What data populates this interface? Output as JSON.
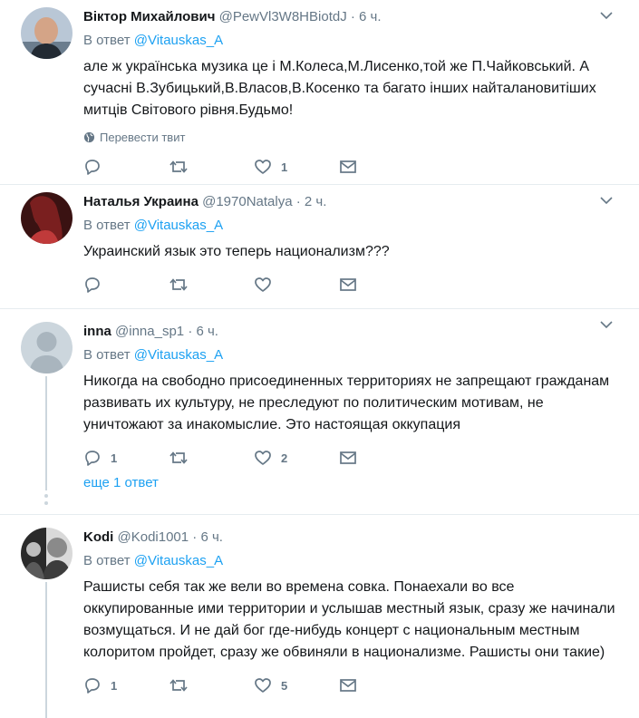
{
  "tweets": [
    {
      "name": "Віктор Михайлович",
      "handle": "@PewVl3W8HBiotdJ",
      "dot": "·",
      "time": "6 ч.",
      "reply_prefix": "В ответ",
      "reply_to": "@Vitauskas_A",
      "text": "але ж українська музика це і М.Колеса,М.Лисенко,той же П.Чайковський. А сучасні В.Зубицький,В.Власов,В.Косенко та багато інших найталановитіших митців Світового рівня.Будьмо!",
      "translate": "Перевести твит",
      "replies": "",
      "retweets": "",
      "likes": "1"
    },
    {
      "name": "Наталья Украина",
      "handle": "@1970Natalya",
      "dot": "·",
      "time": "2 ч.",
      "reply_prefix": "В ответ",
      "reply_to": "@Vitauskas_A",
      "text": "Украинский язык это теперь национализм???",
      "replies": "",
      "retweets": "",
      "likes": ""
    },
    {
      "name": "inna",
      "handle": "@inna_sp1",
      "dot": "·",
      "time": "6 ч.",
      "reply_prefix": "В ответ",
      "reply_to": "@Vitauskas_A",
      "text": "Никогда на свободно присоединенных территориях не запрещают гражданам развивать их культуру, не преследуют по политическим мотивам, не уничтожают за инакомыслие. Это настоящая оккупация",
      "replies": "1",
      "retweets": "",
      "likes": "2",
      "more_replies": "еще 1 ответ"
    },
    {
      "name": "Kodi",
      "handle": "@Kodi1001",
      "dot": "·",
      "time": "6 ч.",
      "reply_prefix": "В ответ",
      "reply_to": "@Vitauskas_A",
      "text": "Рашисты себя так же вели во времена совка. Понаехали во все оккупированные ими территории и услышав местный язык, сразу же начинали возмущаться. И не дай бог где-нибудь концерт с национальным местным колоритом пройдет, сразу же обвиняли в национализме. Рашисты они такие)",
      "replies": "1",
      "retweets": "",
      "likes": "5"
    }
  ],
  "icons": {
    "reply": "reply-icon",
    "retweet": "retweet-icon",
    "like": "heart-icon",
    "dm": "envelope-icon",
    "caret": "chevron-down-icon",
    "globe": "globe-icon"
  },
  "colors": {
    "accent": "#1da1f2",
    "muted": "#657786",
    "border": "#e6ecf0",
    "text": "#14171a"
  }
}
